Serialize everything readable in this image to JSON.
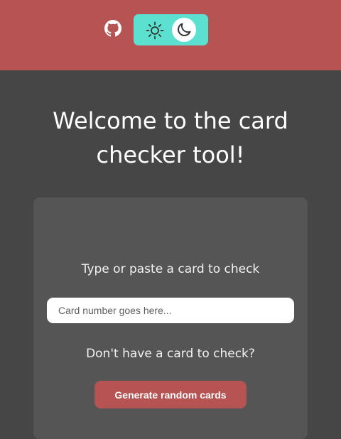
{
  "header": {
    "github_icon": "github-icon",
    "theme_toggle": {
      "light_icon": "sun-icon",
      "dark_icon": "moon-icon",
      "selected": "dark"
    }
  },
  "main": {
    "title": "Welcome to the card checker tool!",
    "prompt": "Type or paste a card to check",
    "input_placeholder": "Card number goes here...",
    "input_value": "",
    "no_card_prompt": "Don't have a card to check?",
    "generate_button_label": "Generate random cards"
  },
  "colors": {
    "header_bg": "#b65353",
    "page_bg": "#464646",
    "panel_bg": "#555555",
    "toggle_bg": "#5ce0cf",
    "button_bg": "#b65353"
  }
}
